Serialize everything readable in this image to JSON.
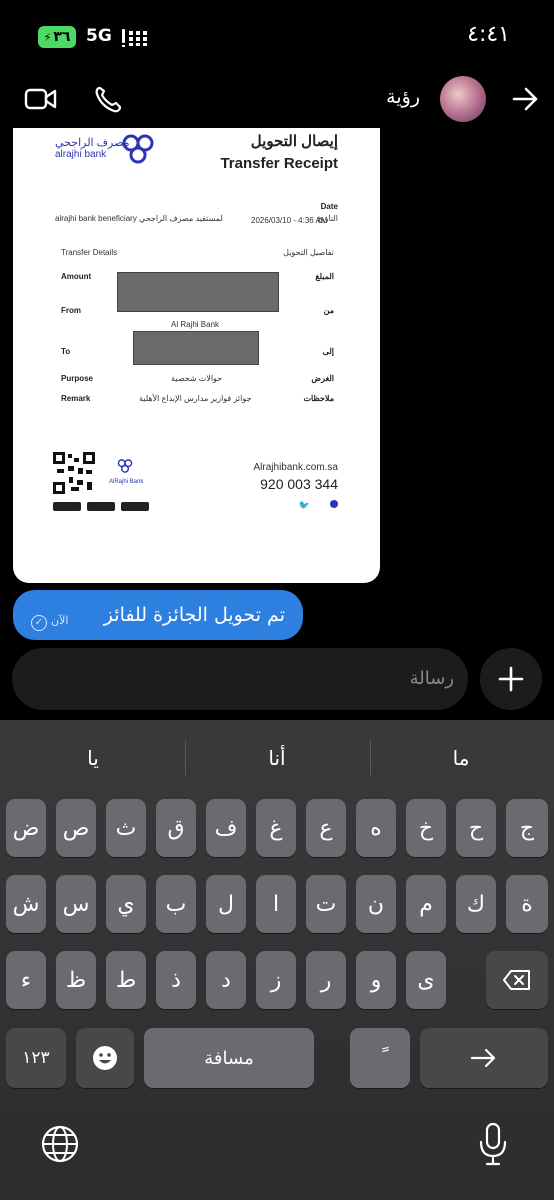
{
  "status_bar": {
    "battery": "٣٦",
    "network": "5G",
    "time": "٤:٤١"
  },
  "header": {
    "contact_name": "رؤية",
    "video_icon": "video-camera-icon",
    "call_icon": "phone-icon",
    "back_icon": "arrow-right-icon"
  },
  "receipt": {
    "title_ar": "إيصال التحويل",
    "title_en": "Transfer Receipt",
    "logo_ar": "مصرف الراجحي",
    "logo_en": "alrajhi bank",
    "date_label_en": "Date",
    "date_label_ar": "التاريخ",
    "date_value": "2026/03/10 - 4:36 AM",
    "beneficiary": "alrajhi bank beneficiary لمستفيد مصرف الراجحي",
    "details_en": "Transfer Details",
    "details_ar": "تفاصيل التحويل",
    "rows": [
      {
        "en": "Amount",
        "ar": "المبلغ",
        "value": ""
      },
      {
        "en": "From",
        "ar": "من",
        "value": "Al Rajhi Bank"
      },
      {
        "en": "To",
        "ar": "إلى",
        "value": ""
      },
      {
        "en": "Purpose",
        "ar": "الغرض",
        "value": "حوالات شخصية"
      },
      {
        "en": "Remark",
        "ar": "ملاحظات",
        "value": "جوائز فوازير مدارس الإبداع الأهلية"
      }
    ],
    "footer_logo": "AlRajhi Bank",
    "website": "Alrajhibank.com.sa",
    "phone": "920 003 344",
    "stores": [
      "App Store",
      "Google play",
      "AppGallery"
    ]
  },
  "message": {
    "text": "تم تحويل الجائزة للفائز",
    "time": "الآن"
  },
  "composer": {
    "placeholder": "رسالة"
  },
  "keyboard": {
    "suggestions": [
      "ما",
      "أنا",
      "يا"
    ],
    "row1": [
      "ض",
      "ص",
      "ث",
      "ق",
      "ف",
      "غ",
      "ع",
      "ه",
      "خ",
      "ح",
      "ج"
    ],
    "row2": [
      "ش",
      "س",
      "ي",
      "ب",
      "ل",
      "ا",
      "ت",
      "ن",
      "م",
      "ك",
      "ة"
    ],
    "row3": [
      "ء",
      "ظ",
      "ط",
      "ذ",
      "د",
      "ز",
      "ر",
      "و",
      "ى"
    ],
    "numbers_key": "١٢٣",
    "space_key": "مسافة",
    "diacritic_key": "ً"
  },
  "colors": {
    "bubble": "#2d7fe0",
    "bank_blue": "#2a35b5",
    "battery": "#4cd964"
  }
}
